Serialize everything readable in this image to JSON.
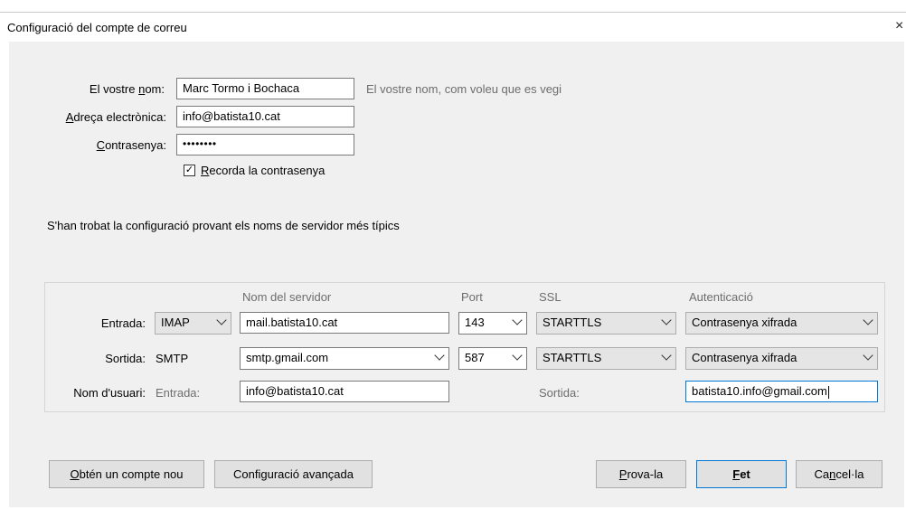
{
  "window": {
    "title": "Configuració del compte de correu",
    "close_glyph": "×"
  },
  "form": {
    "name_label_pre": "El vostre ",
    "name_label_ul": "n",
    "name_label_post": "om:",
    "name_value": "Marc Tormo i Bochaca",
    "name_hint": "El vostre nom, com voleu que es vegi",
    "email_label_ul": "A",
    "email_label_post": "dreça electrònica:",
    "email_value": "info@batista10.cat",
    "password_label_ul": "C",
    "password_label_post": "ontrasenya:",
    "password_value": "••••••••",
    "remember_check": "✓",
    "remember_label_ul": "R",
    "remember_label_post": "ecorda la contrasenya"
  },
  "status": "S'han trobat la configuració provant els noms de servidor més típics",
  "servers": {
    "headers": {
      "server": "Nom del servidor",
      "port": "Port",
      "ssl": "SSL",
      "auth": "Autenticació"
    },
    "incoming": {
      "label": "Entrada:",
      "protocol": "IMAP",
      "server": "mail.batista10.cat",
      "port": "143",
      "ssl": "STARTTLS",
      "auth": "Contrasenya xifrada"
    },
    "outgoing": {
      "label": "Sortida:",
      "protocol": "SMTP",
      "server": "smtp.gmail.com",
      "port": "587",
      "ssl": "STARTTLS",
      "auth": "Contrasenya xifrada"
    },
    "username": {
      "label": "Nom d'usuari:",
      "incoming_label": "Entrada:",
      "incoming_value": "info@batista10.cat",
      "outgoing_label": "Sortida:",
      "outgoing_value": "batista10.info@gmail.com"
    }
  },
  "buttons": {
    "new_account_ul": "O",
    "new_account_post": "btén un compte nou",
    "advanced_pre": "Confi",
    "advanced_ul": "g",
    "advanced_post": "uració avançada",
    "test_ul": "P",
    "test_post": "rova-la",
    "done_ul": "F",
    "done_post": "et",
    "cancel_pre": "Ca",
    "cancel_ul": "n",
    "cancel_post": "cel·la"
  }
}
